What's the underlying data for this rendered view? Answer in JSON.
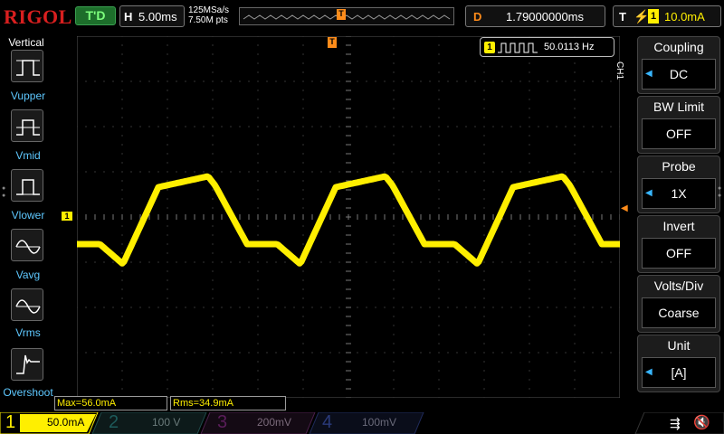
{
  "topbar": {
    "logo": "RIGOL",
    "trigger_status": "T'D",
    "horizontal": {
      "key": "H",
      "value": "5.00ms"
    },
    "sample_rate": "125MSa/s",
    "mem_depth": "7.50M pts",
    "delay": {
      "key": "D",
      "value": "1.79000000ms"
    },
    "trigger": {
      "key": "T",
      "edge_icon": "rising-edge-icon",
      "source": "1",
      "level": "10.0mA"
    }
  },
  "left_menu": {
    "title": "Vertical",
    "items": [
      {
        "label": "Vupper",
        "icon": "vupper-icon"
      },
      {
        "label": "Vmid",
        "icon": "vmid-icon"
      },
      {
        "label": "Vlower",
        "icon": "vlower-icon"
      },
      {
        "label": "Vavg",
        "icon": "vavg-icon"
      },
      {
        "label": "Vrms",
        "icon": "vrms-icon"
      },
      {
        "label": "Overshoot",
        "icon": "overshoot-icon"
      }
    ]
  },
  "markers": {
    "trigger_pos": "T",
    "channel_ground": "1",
    "trigger_level": "T"
  },
  "freq_counter": {
    "channel": "1",
    "value": "50.0113 Hz"
  },
  "measurements": {
    "max": "Max=56.0mA",
    "rms": "Rms=34.9mA"
  },
  "right_menu": {
    "channel_tag": "CH1",
    "items": [
      {
        "label": "Coupling",
        "value": "DC"
      },
      {
        "label": "BW Limit",
        "value": "OFF"
      },
      {
        "label": "Probe",
        "value": "1X"
      },
      {
        "label": "Invert",
        "value": "OFF"
      },
      {
        "label": "Volts/Div",
        "value": "Coarse"
      },
      {
        "label": "Unit",
        "value": "[A]"
      }
    ]
  },
  "channels": [
    {
      "num": "1",
      "scale": "50.0mA",
      "color": "#ffef00",
      "active": true
    },
    {
      "num": "2",
      "scale": "100 V",
      "color": "#00c2c2",
      "active": false
    },
    {
      "num": "3",
      "scale": "200mV",
      "color": "#d000d0",
      "active": false
    },
    {
      "num": "4",
      "scale": "100mV",
      "color": "#3070ff",
      "active": false
    }
  ],
  "colors": {
    "ch1": "#ffef00",
    "trigger": "#ff8c1a",
    "menu_label": "#5ec8ff"
  }
}
